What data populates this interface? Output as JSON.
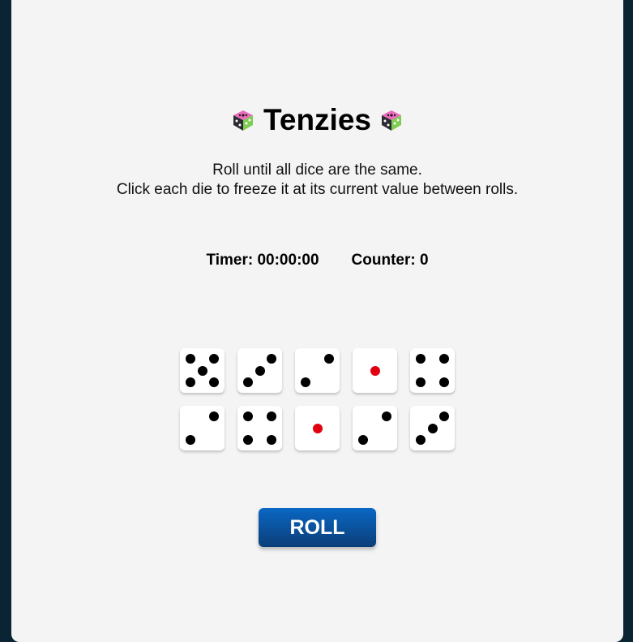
{
  "header": {
    "title": "Tenzies",
    "left_icon": "dice-icon",
    "right_icon": "dice-icon"
  },
  "instructions": {
    "line1": "Roll until all dice are the same.",
    "line2": "Click each die to freeze it at its current value between rolls."
  },
  "stats": {
    "timer_label": "Timer: 00:00:00",
    "counter_label": "Counter: 0"
  },
  "dice": [
    5,
    3,
    2,
    1,
    4,
    2,
    4,
    1,
    2,
    3
  ],
  "colors": {
    "background": "#0b2434",
    "card": "#f4f4f4",
    "pip": "#000000",
    "single_pip": "#e1000f",
    "button": "#0b4f98"
  },
  "roll_button": {
    "label": "ROLL"
  }
}
